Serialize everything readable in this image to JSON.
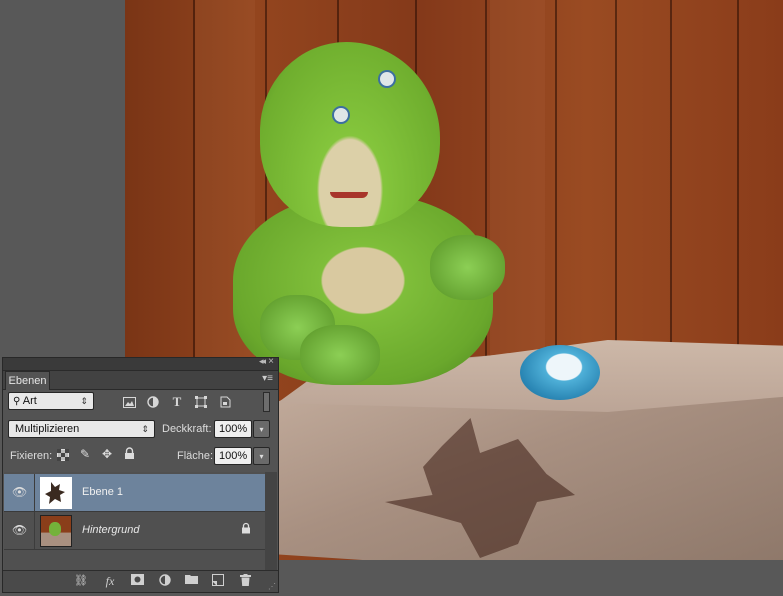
{
  "panel": {
    "tab_label": "Ebenen",
    "filter": {
      "kind_value": "Art"
    },
    "blend_mode": {
      "value": "Multiplizieren"
    },
    "opacity": {
      "label": "Deckkraft:",
      "value": "100%"
    },
    "lock": {
      "label": "Fixieren:"
    },
    "fill": {
      "label": "Fläche:",
      "value": "100%"
    },
    "layers": [
      {
        "name": "Ebene 1",
        "selected": true,
        "visible": true,
        "locked": false
      },
      {
        "name": "Hintergrund",
        "selected": false,
        "visible": true,
        "locked": true
      }
    ],
    "filter_icons": [
      "image-filter-icon",
      "adjustment-filter-icon",
      "text-filter-icon",
      "shape-filter-icon",
      "smart-object-filter-icon"
    ],
    "lock_icons": [
      "lock-transparent-pixels-icon",
      "lock-image-pixels-icon",
      "lock-position-icon",
      "lock-all-icon"
    ],
    "bottom_icons": [
      "link-layers-icon",
      "fx-icon",
      "layer-mask-icon",
      "adjustment-layer-icon",
      "group-folder-icon",
      "new-layer-icon",
      "trash-icon"
    ],
    "fx_label": "fx"
  },
  "colors": {
    "panel_bg": "#535353",
    "selected_layer": "#6d839c",
    "workspace": "#585858"
  }
}
